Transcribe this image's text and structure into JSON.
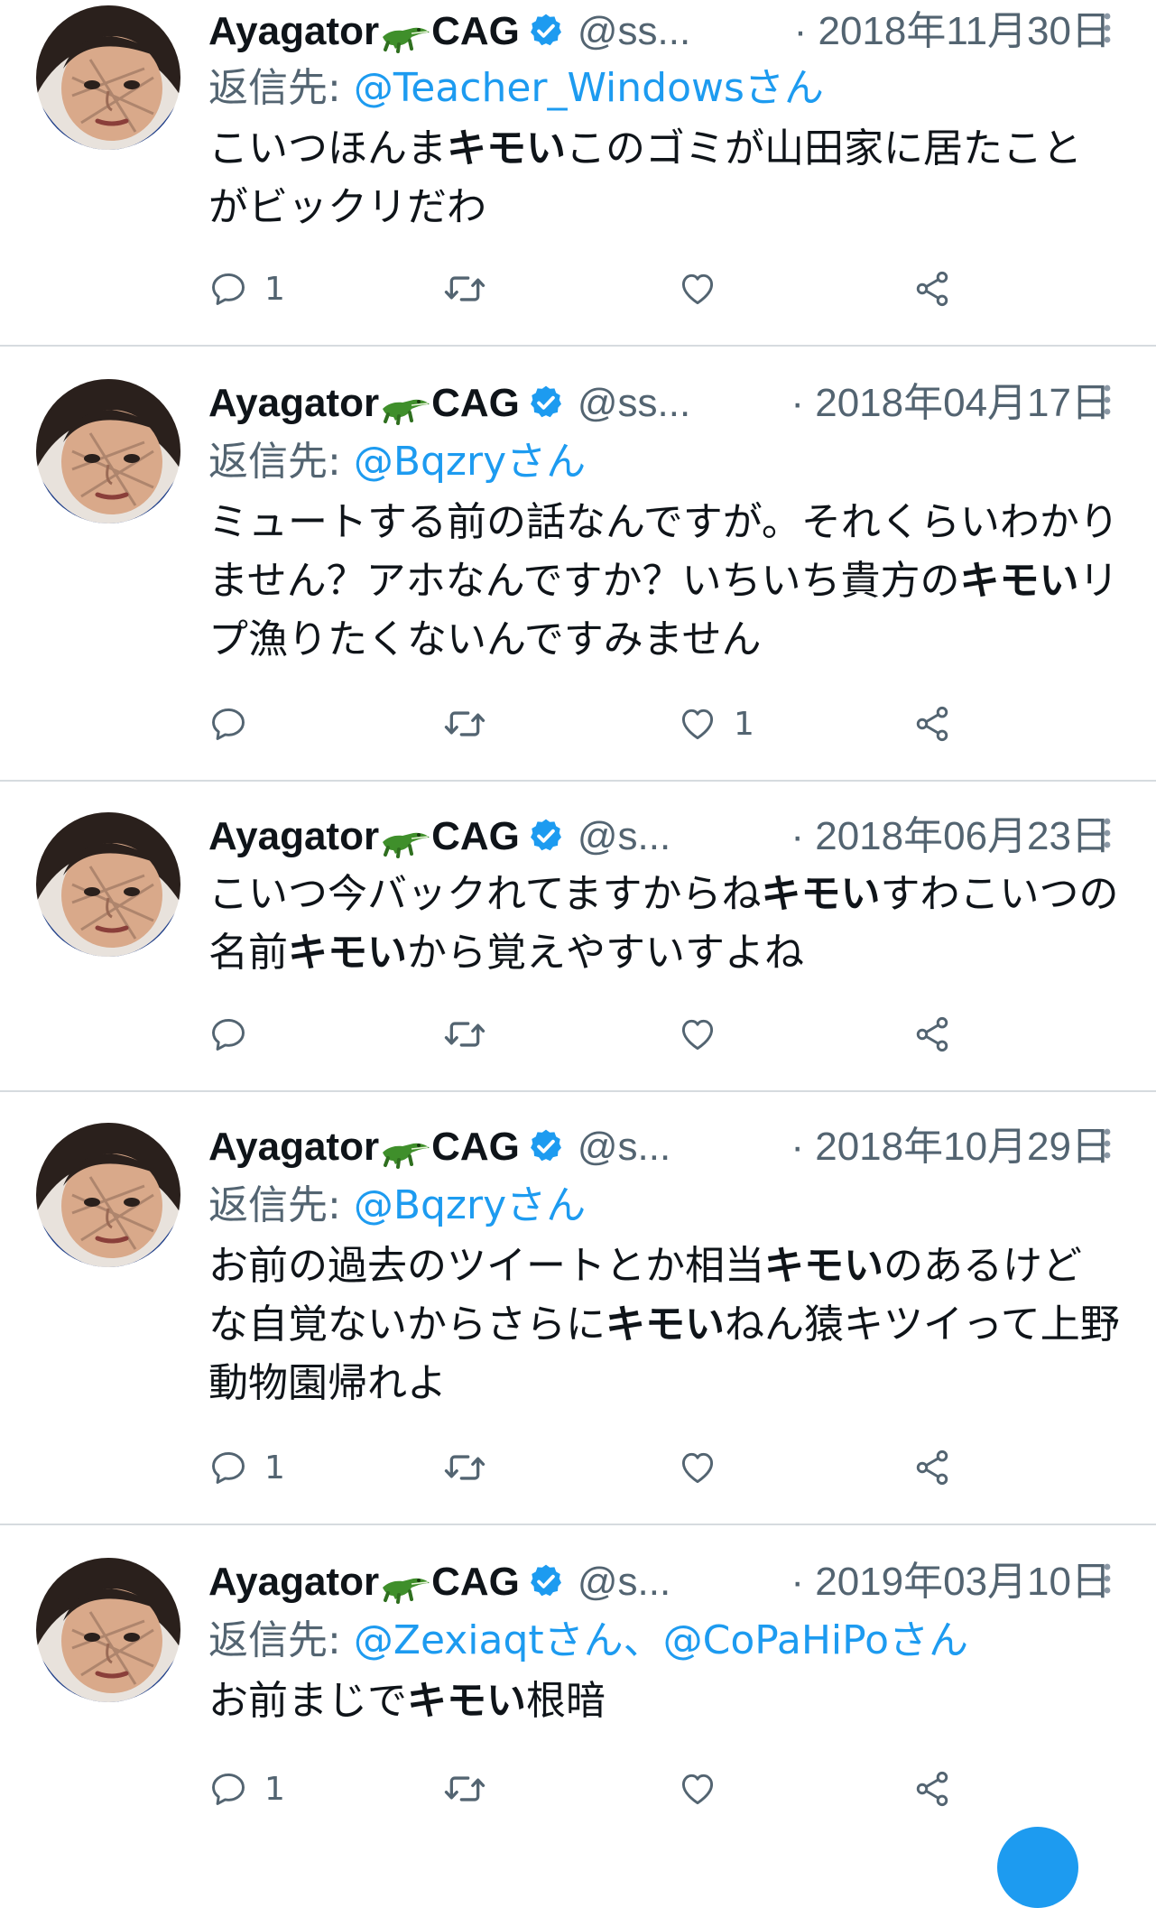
{
  "icons": {
    "reply": "reply-icon",
    "retweet": "retweet-icon",
    "like": "heart-icon",
    "share": "share-icon",
    "more": "more-vertical-icon",
    "verified": "verified-badge-icon",
    "emoji": "crocodile-emoji-icon"
  },
  "colors": {
    "accent": "#1d9bf0",
    "secondary_text": "#536471",
    "divider": "#d6dbdf"
  },
  "tweets": [
    {
      "name_a": "Ayagator",
      "name_b": "CAG",
      "handle": "@ss...",
      "date": "· 2018年11月30日",
      "reply_prefix": "返信先: ",
      "reply_to": "@Teacher_Windowsさん",
      "text": "こいつほんまキモいこのゴミが山田家に居たことがビックリだわ",
      "reply_count": "1",
      "like_count": ""
    },
    {
      "name_a": "Ayagator",
      "name_b": "CAG",
      "handle": "@ss...",
      "date": "· 2018年04月17日",
      "reply_prefix": "返信先: ",
      "reply_to": "@Bqzryさん",
      "text": "ミュートする前の話なんですが。それくらいわかりません？アホなんですか？いちいち貴方のキモいリプ漁りたくないんですみません",
      "reply_count": "",
      "like_count": "1"
    },
    {
      "name_a": "Ayagator",
      "name_b": "CAG",
      "handle": "@s...",
      "date": "· 2018年06月23日",
      "reply_prefix": "",
      "reply_to": "",
      "text": "こいつ今バックれてますからねキモいすわこいつの名前キモいから覚えやすいすよね",
      "reply_count": "",
      "like_count": ""
    },
    {
      "name_a": "Ayagator",
      "name_b": "CAG",
      "handle": "@s...",
      "date": "· 2018年10月29日",
      "reply_prefix": "返信先: ",
      "reply_to": "@Bqzryさん",
      "text": "お前の過去のツイートとか相当キモいのあるけどな自覚ないからさらにキモいねん猿キツイって上野動物園帰れよ",
      "reply_count": "1",
      "like_count": ""
    },
    {
      "name_a": "Ayagator",
      "name_b": "CAG",
      "handle": "@s...",
      "date": "· 2019年03月10日",
      "reply_prefix": "返信先: ",
      "reply_to": "@Zexiaqtさん、@CoPaHiPoさん",
      "text": "お前まじでキモい根暗",
      "reply_count": "1",
      "like_count": ""
    }
  ]
}
